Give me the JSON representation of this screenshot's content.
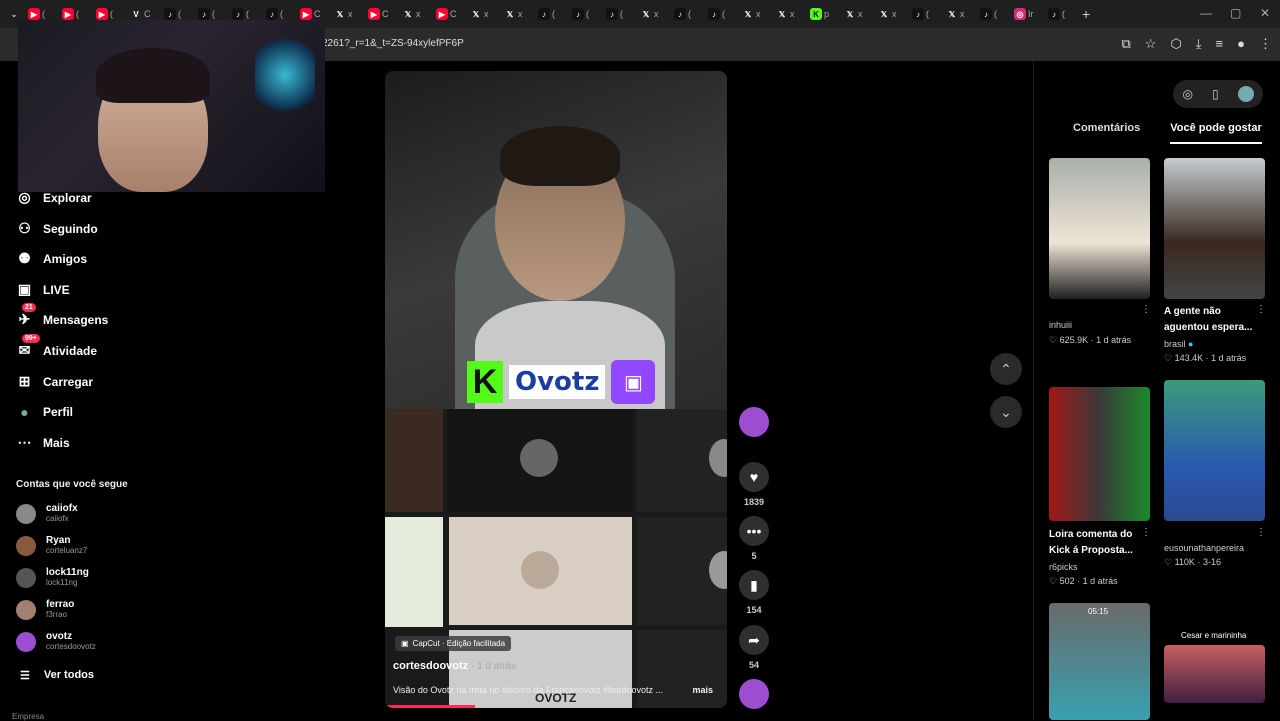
{
  "browser": {
    "tabs": [
      {
        "icon": "youtube",
        "label": "("
      },
      {
        "icon": "youtube",
        "label": "("
      },
      {
        "icon": "youtube",
        "label": "("
      },
      {
        "icon": "v",
        "label": "C"
      },
      {
        "icon": "tiktok",
        "label": "("
      },
      {
        "icon": "tiktok",
        "label": "("
      },
      {
        "icon": "tiktok",
        "label": "("
      },
      {
        "icon": "tiktok",
        "label": "("
      },
      {
        "icon": "youtube",
        "label": "C"
      },
      {
        "icon": "x",
        "label": "x"
      },
      {
        "icon": "youtube",
        "label": "C"
      },
      {
        "icon": "x",
        "label": "x"
      },
      {
        "icon": "youtube",
        "label": "C"
      },
      {
        "icon": "x",
        "label": "x"
      },
      {
        "icon": "x",
        "label": "x"
      },
      {
        "icon": "tiktok",
        "label": "("
      },
      {
        "icon": "tiktok",
        "label": "("
      },
      {
        "icon": "tiktok",
        "label": "("
      },
      {
        "icon": "x",
        "label": "x"
      },
      {
        "icon": "tiktok",
        "label": "("
      },
      {
        "icon": "tiktok",
        "label": "("
      },
      {
        "icon": "x",
        "label": "x"
      },
      {
        "icon": "x",
        "label": "x"
      },
      {
        "icon": "kick",
        "label": "p"
      },
      {
        "icon": "x",
        "label": "x"
      },
      {
        "icon": "x",
        "label": "x"
      },
      {
        "icon": "tiktok",
        "label": "("
      },
      {
        "icon": "x",
        "label": "x"
      },
      {
        "icon": "tiktok",
        "label": "("
      },
      {
        "icon": "instagram",
        "label": "Ir"
      },
      {
        "icon": "tiktok",
        "label": "("
      }
    ],
    "new_tab": "+",
    "url": "2261?_r=1&_t=ZS-94xylefPF6P"
  },
  "sidebar": {
    "items": [
      {
        "label": "Explorar",
        "icon": "compass-icon"
      },
      {
        "label": "Seguindo",
        "icon": "following-icon"
      },
      {
        "label": "Amigos",
        "icon": "friends-icon"
      },
      {
        "label": "LIVE",
        "icon": "live-icon"
      },
      {
        "label": "Mensagens",
        "icon": "messages-icon",
        "badge": "21"
      },
      {
        "label": "Atividade",
        "icon": "activity-icon",
        "badge": "99+"
      },
      {
        "label": "Carregar",
        "icon": "upload-icon"
      },
      {
        "label": "Perfil",
        "icon": "profile-icon"
      },
      {
        "label": "Mais",
        "icon": "more-icon"
      }
    ],
    "following_title": "Contas que você segue",
    "following": [
      {
        "name": "caiiofx",
        "handle": "caiiofx",
        "color": "#888888"
      },
      {
        "name": "Ryan",
        "handle": "corteluanz7",
        "color": "#8a5a40"
      },
      {
        "name": "lock11ng",
        "handle": "lock11ng",
        "color": "#555555"
      },
      {
        "name": "ferrao",
        "handle": "f3rrao",
        "color": "#a08070"
      },
      {
        "name": "ovotz",
        "handle": "cortesdoovotz",
        "color": "#9b4fd0"
      }
    ],
    "see_all": "Ver todos",
    "footer": "Empresa"
  },
  "video": {
    "logo_text": "Ovotz",
    "capcut": "CapCut · Edição facilitada",
    "author": "cortesdoovotz",
    "time": " · 1 d atrás",
    "description": "Visão do Ovotz na treta no discord da França#ovotz #livedoovotz ...",
    "more": "mais",
    "overlay_name": "OVOTZ"
  },
  "actions": {
    "likes": "1839",
    "comments": "5",
    "saves": "154",
    "shares": "54"
  },
  "right_panel": {
    "tabs": [
      "Comentários",
      "Você pode gostar"
    ],
    "videos": [
      {
        "caption": "",
        "author": "inhuiii",
        "likes": "625.9K",
        "time": "1 d atrás"
      },
      {
        "caption": "A gente não aguentou espera...",
        "author": "brasil",
        "likes": "143.4K",
        "time": "1 d atrás"
      },
      {
        "caption": "Loira comenta do Kick á Proposta...",
        "author": "r6picks",
        "likes": "502",
        "time": "1 d atrás"
      },
      {
        "caption": "",
        "author": "eusounathanpereira",
        "likes": "110K",
        "time": "3-16"
      },
      {
        "overlay": "05:15"
      },
      {
        "overlay": "Cesar e marininha"
      }
    ]
  },
  "colors": {
    "accent": "#fe2c55",
    "kick": "#53fc18",
    "twitch": "#9146ff",
    "verified": "#20d5ec"
  }
}
